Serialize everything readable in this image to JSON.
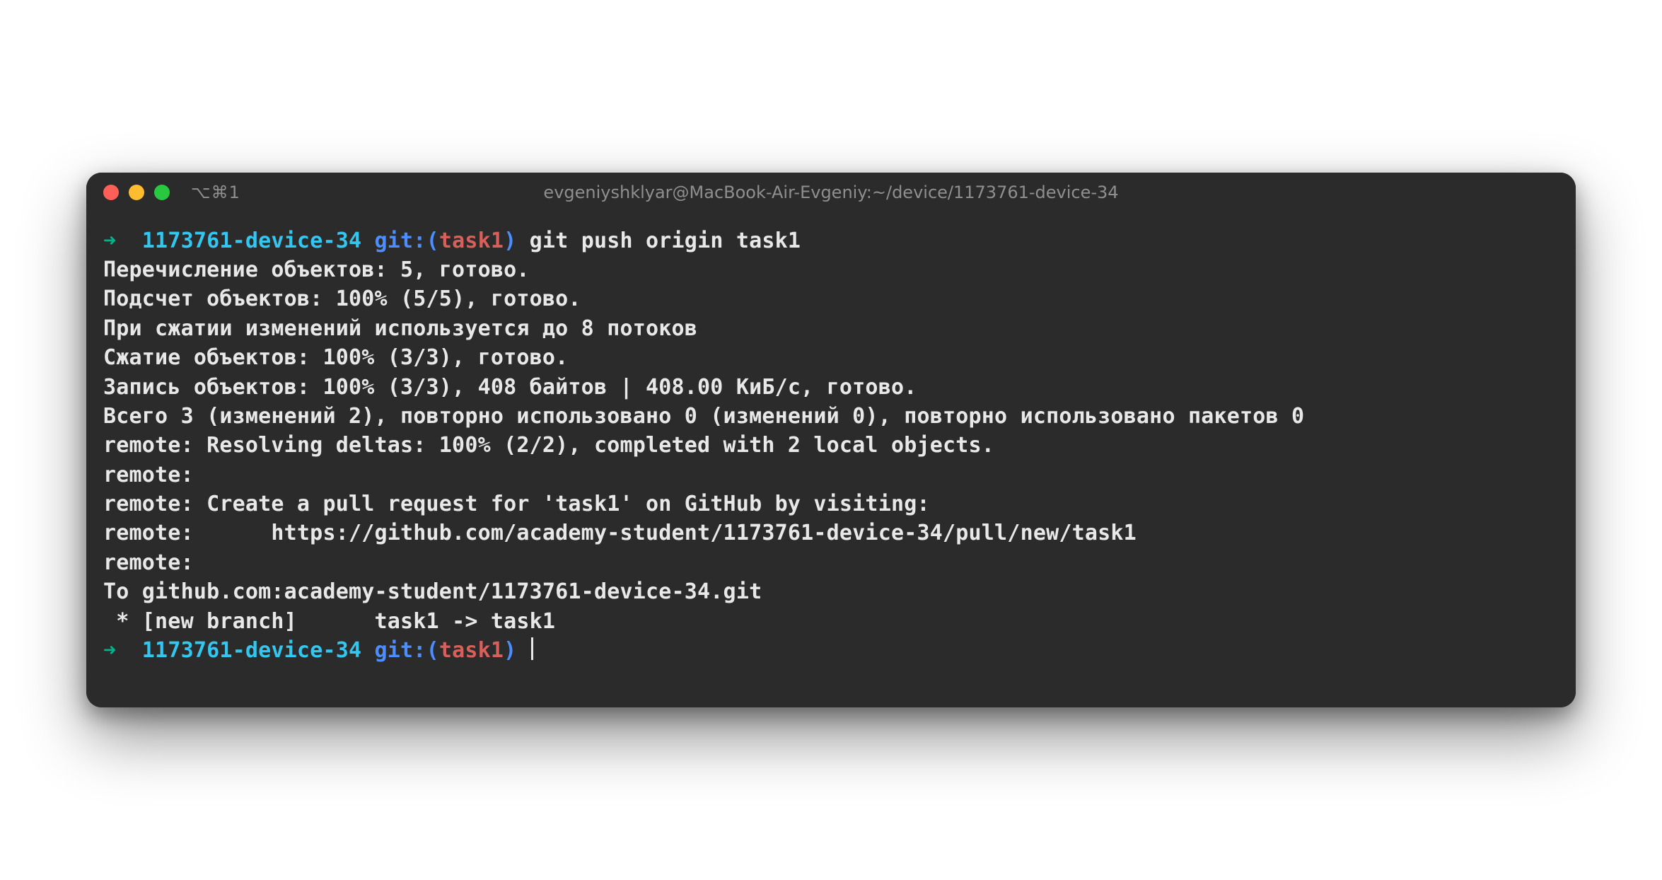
{
  "window": {
    "tab_indicator": "⌥⌘1",
    "title": "evgeniyshklyar@MacBook-Air-Evgeniy:~/device/1173761-device-34"
  },
  "prompt1": {
    "arrow": "➜",
    "dir": "1173761-device-34",
    "git_label": "git:",
    "paren_open": "(",
    "branch": "task1",
    "paren_close": ")",
    "command": "git push origin task1"
  },
  "output": {
    "l1": "Перечисление объектов: 5, готово.",
    "l2": "Подсчет объектов: 100% (5/5), готово.",
    "l3": "При сжатии изменений используется до 8 потоков",
    "l4": "Сжатие объектов: 100% (3/3), готово.",
    "l5": "Запись объектов: 100% (3/3), 408 байтов | 408.00 КиБ/с, готово.",
    "l6": "Всего 3 (изменений 2), повторно использовано 0 (изменений 0), повторно использовано пакетов 0",
    "l7": "remote: Resolving deltas: 100% (2/2), completed with 2 local objects.",
    "l8": "remote:",
    "l9": "remote: Create a pull request for 'task1' on GitHub by visiting:",
    "l10": "remote:      https://github.com/academy-student/1173761-device-34/pull/new/task1",
    "l11": "remote:",
    "l12": "To github.com:academy-student/1173761-device-34.git",
    "l13": " * [new branch]      task1 -> task1"
  },
  "prompt2": {
    "arrow": "➜",
    "dir": "1173761-device-34",
    "git_label": "git:",
    "paren_open": "(",
    "branch": "task1",
    "paren_close": ")"
  }
}
